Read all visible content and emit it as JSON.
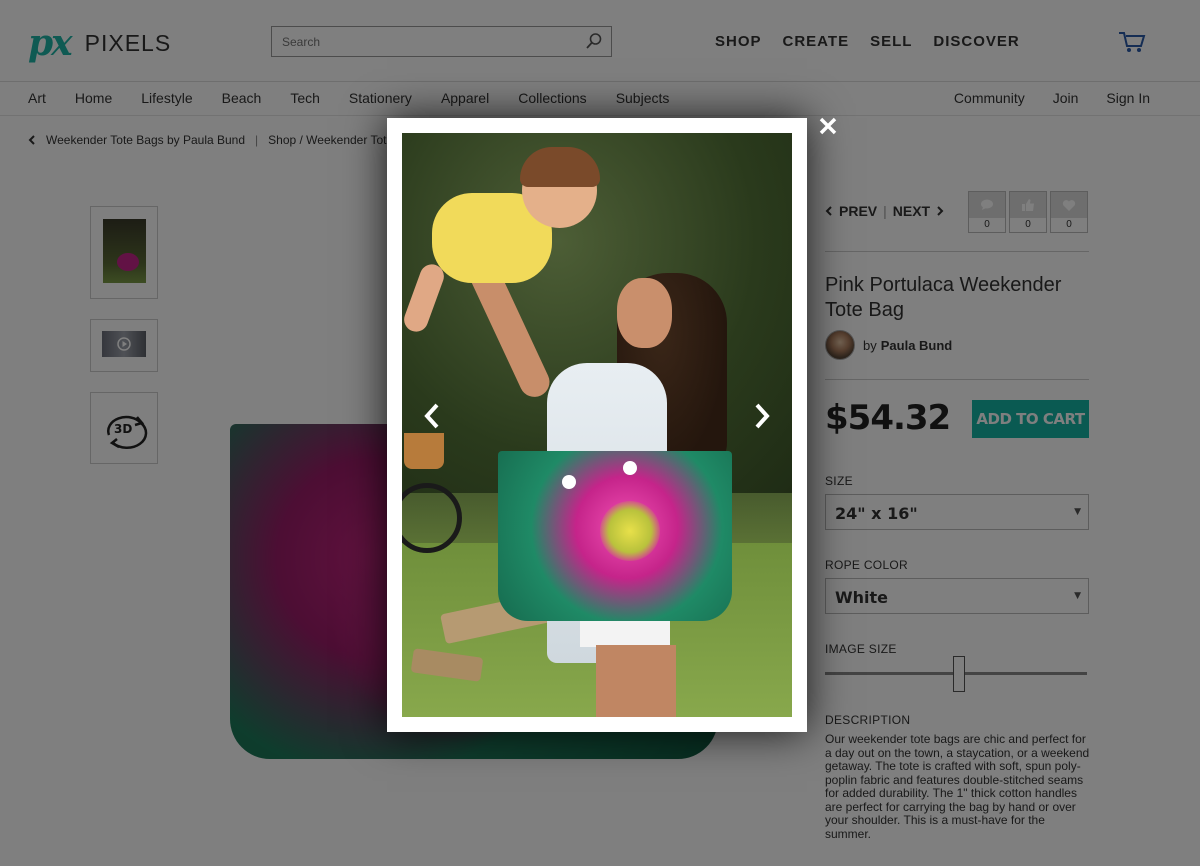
{
  "header": {
    "logo_mark": "px",
    "logo_text": "PIXELS",
    "search_placeholder": "Search",
    "nav": [
      "SHOP",
      "CREATE",
      "SELL",
      "DISCOVER"
    ]
  },
  "categories": {
    "left": [
      "Art",
      "Home",
      "Lifestyle",
      "Beach",
      "Tech",
      "Stationery",
      "Apparel",
      "Collections",
      "Subjects"
    ],
    "right": [
      "Community",
      "Join",
      "Sign In"
    ]
  },
  "breadcrumb": {
    "back_label": "Weekender Tote Bags by Paula Bund",
    "separator": "|",
    "path": "Shop / Weekender Tote"
  },
  "product": {
    "prev": "PREV",
    "separator": "|",
    "next": "NEXT",
    "social": [
      {
        "icon": "comment-icon",
        "count": "0"
      },
      {
        "icon": "thumbs-up-icon",
        "count": "0"
      },
      {
        "icon": "heart-icon",
        "count": "0"
      }
    ],
    "title": "Pink Portulaca Weekender Tote Bag",
    "by": "by",
    "artist": "Paula Bund",
    "price": "$54.32",
    "add_to_cart": "ADD TO CART",
    "size_label": "SIZE",
    "size_value": "24\" x 16\"",
    "rope_label": "ROPE COLOR",
    "rope_value": "White",
    "image_size_label": "IMAGE SIZE",
    "image_size_level": 0.51,
    "description_label": "DESCRIPTION",
    "description": "Our weekender tote bags are chic and perfect for a day out on the town, a staycation, or a weekend getaway.   The tote is crafted with soft, spun poly-poplin fabric and features double-stitched seams for added durability.   The 1\" thick cotton handles are perfect for carrying the bag by hand or over your shoulder.   This is a must-have for the summer."
  },
  "thumbnails": [
    {
      "name": "lifestyle-photo"
    },
    {
      "name": "video-thumbnail"
    },
    {
      "name": "3d-view",
      "label": "3D"
    }
  ],
  "colors": {
    "accent": "#14b4a4",
    "overlay": "rgba(0,0,0,0.5)"
  }
}
